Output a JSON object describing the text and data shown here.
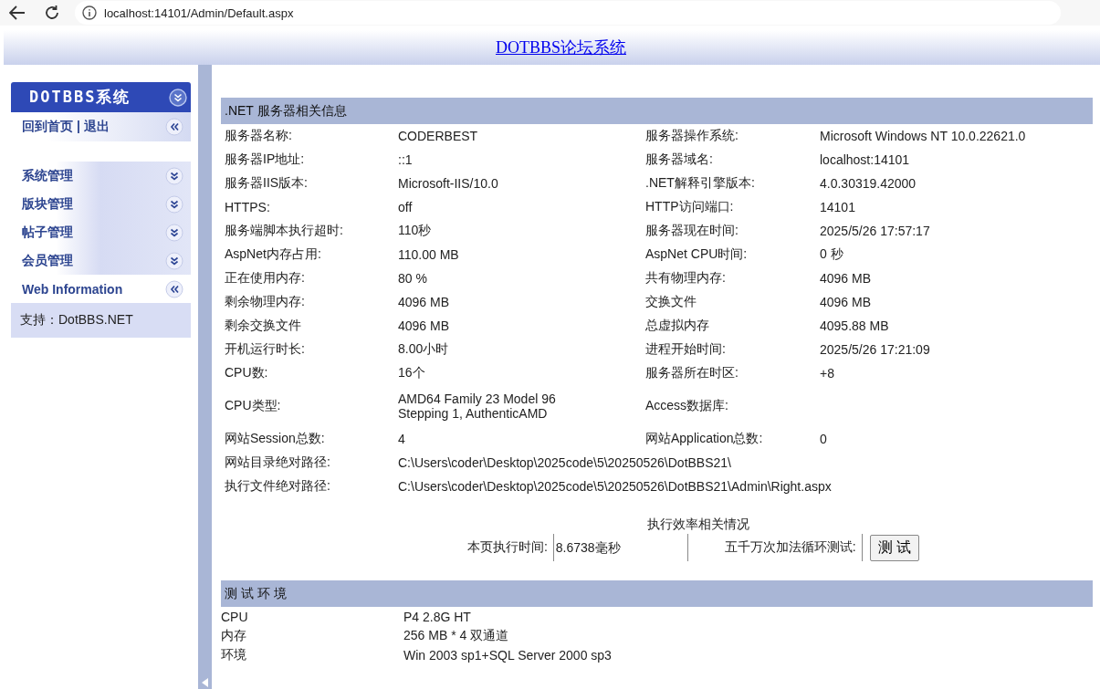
{
  "browser": {
    "url": "localhost:14101/Admin/Default.aspx"
  },
  "header": {
    "title": "DOTBBS论坛系统"
  },
  "sidebar": {
    "title": "DOTBBS系统",
    "quick_links": {
      "links": [
        "回到首页",
        "退出"
      ],
      "separator": "|",
      "expanded": true
    },
    "items": [
      {
        "label": "系统管理",
        "expanded": false
      },
      {
        "label": "版块管理",
        "expanded": false
      },
      {
        "label": "帖子管理",
        "expanded": false
      },
      {
        "label": "会员管理",
        "expanded": false
      },
      {
        "label": "Web Information",
        "expanded": true
      }
    ],
    "support": "支持：DotBBS.NET"
  },
  "server_info": {
    "title": ".NET 服务器相关信息",
    "rows": [
      {
        "label": "服务器名称:",
        "value": "CODERBEST",
        "label_2": "服务器操作系统:",
        "value_2": "Microsoft Windows NT 10.0.22621.0"
      },
      {
        "label": "服务器IP地址:",
        "value": "::1",
        "label_2": "服务器域名:",
        "value_2": "localhost:14101"
      },
      {
        "label": "服务器IIS版本:",
        "value": "Microsoft-IIS/10.0",
        "label_2": ".NET解释引擎版本:",
        "value_2": "4.0.30319.42000"
      },
      {
        "label": "HTTPS:",
        "value": "off",
        "label_2": "HTTP访问端口:",
        "value_2": "14101"
      },
      {
        "label": "服务端脚本执行超时:",
        "value": "110秒",
        "label_2": "服务器现在时间:",
        "value_2": "2025/5/26 17:57:17"
      },
      {
        "label": "AspNet内存占用:",
        "value": "110.00 MB",
        "label_2": "AspNet CPU时间:",
        "value_2": "0 秒"
      },
      {
        "label": "正在使用内存:",
        "value": "80 %",
        "label_2": "共有物理内存:",
        "value_2": "4096 MB"
      },
      {
        "label": "剩余物理内存:",
        "value": "4096 MB",
        "label_2": "交换文件",
        "value_2": "4096 MB"
      },
      {
        "label": "剩余交换文件",
        "value": "4096 MB",
        "label_2": "总虚拟内存",
        "value_2": "4095.88 MB"
      },
      {
        "label": "开机运行时长:",
        "value": "8.00小时",
        "label_2": "进程开始时间:",
        "value_2": "2025/5/26 17:21:09"
      },
      {
        "label": "CPU数:",
        "value": "16个",
        "label_2": "服务器所在时区:",
        "value_2": "+8"
      },
      {
        "label": "CPU类型:",
        "value": "AMD64 Family 23 Model 96 Stepping 1, AuthenticAMD",
        "label_2": "Access数据库:"
      },
      {
        "label": "网站Session总数:",
        "value": "4",
        "label_2": "网站Application总数:",
        "value_2": "0"
      },
      {
        "label": "网站目录绝对路径:",
        "value": "C:\\Users\\coder\\Desktop\\2025code\\5\\20250526\\DotBBS21\\"
      },
      {
        "label": "执行文件绝对路径:",
        "value": "C:\\Users\\coder\\Desktop\\2025code\\5\\20250526\\DotBBS21\\Admin\\Right.aspx"
      }
    ]
  },
  "performance": {
    "title": "执行效率相关情况",
    "page_time_label": "本页执行时间:",
    "page_time_value": "8.6738毫秒",
    "loop_test_label": "五千万次加法循环测试:",
    "test_button": "测 试"
  },
  "test_env": {
    "title": "测 试 环 境",
    "rows": [
      {
        "label": "CPU",
        "value": "P4 2.8G HT"
      },
      {
        "label": "内存",
        "value": "256 MB * 4 双通道"
      },
      {
        "label": "环境",
        "value": "Win 2003 sp1+SQL Server 2000 sp3"
      }
    ]
  }
}
